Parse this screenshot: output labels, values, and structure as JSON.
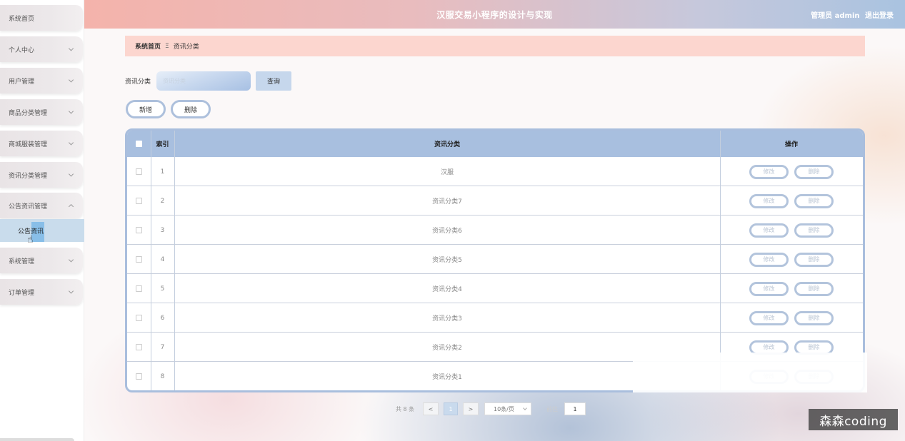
{
  "header": {
    "title": "汉服交易小程序的设计与实现",
    "user_label": "管理员 admin",
    "logout_label": "退出登录"
  },
  "sidebar": {
    "items": [
      {
        "label": "系统首页",
        "has_arrow": false
      },
      {
        "label": "个人中心",
        "has_arrow": true
      },
      {
        "label": "用户管理",
        "has_arrow": true
      },
      {
        "label": "商品分类管理",
        "has_arrow": true
      },
      {
        "label": "商城服装管理",
        "has_arrow": true
      },
      {
        "label": "资讯分类管理",
        "has_arrow": true
      },
      {
        "label": "公告资讯管理",
        "has_arrow": true,
        "expanded": true
      },
      {
        "label": "系统管理",
        "has_arrow": true
      },
      {
        "label": "订单管理",
        "has_arrow": true
      }
    ],
    "sub_item": {
      "label": "公告资讯"
    }
  },
  "breadcrumb": {
    "home": "系统首页",
    "separator": "Ξ",
    "current": "资讯分类"
  },
  "search": {
    "label": "资讯分类",
    "placeholder": "资讯分类",
    "query_label": "查询"
  },
  "actions": {
    "add_label": "新增",
    "delete_label": "删除"
  },
  "table": {
    "headers": {
      "index": "索引",
      "category": "资讯分类",
      "ops": "操作"
    },
    "edit_label": "修改",
    "delete_label": "删除",
    "rows": [
      {
        "index": "1",
        "category": "汉服"
      },
      {
        "index": "2",
        "category": "资讯分类7"
      },
      {
        "index": "3",
        "category": "资讯分类6"
      },
      {
        "index": "4",
        "category": "资讯分类5"
      },
      {
        "index": "5",
        "category": "资讯分类4"
      },
      {
        "index": "6",
        "category": "资讯分类3"
      },
      {
        "index": "7",
        "category": "资讯分类2"
      },
      {
        "index": "8",
        "category": "资讯分类1"
      }
    ]
  },
  "pagination": {
    "total": "共 8 条",
    "prev": "<",
    "current": "1",
    "next": ">",
    "page_size": "10条/页",
    "goto_label": "前往",
    "goto_value": "1"
  },
  "watermark": "森森coding",
  "colors": {
    "accent": "#a8bfdf",
    "breadcrumb_bg": "#fcd6cf",
    "header_left": "#f4b3ab",
    "header_right": "#a9c3e0"
  }
}
